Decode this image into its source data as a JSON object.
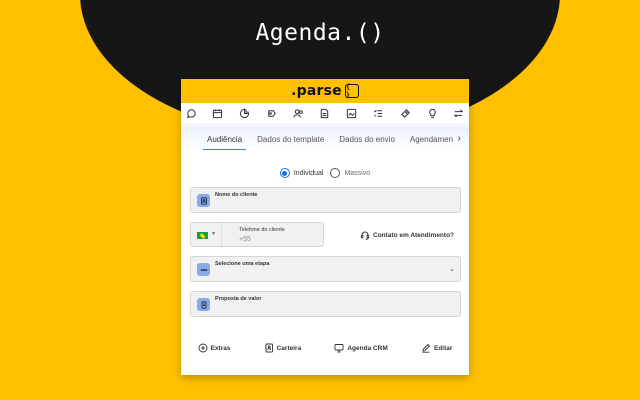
{
  "hero": {
    "title": "Agenda.()"
  },
  "brand": {
    "name": ".parse",
    "badge": "{ }"
  },
  "toolbar": {
    "icons": [
      "chat-bubble-icon",
      "calendar-icon",
      "pie-chart-icon",
      "tag-shield-icon",
      "users-icon",
      "document-icon",
      "image-gallery-icon",
      "list-check-icon",
      "ticket-icon",
      "lightbulb-icon",
      "swap-arrows-icon"
    ]
  },
  "tabs": {
    "items": [
      {
        "label": "Audiência"
      },
      {
        "label": "Dados do template"
      },
      {
        "label": "Dados do envio"
      },
      {
        "label": "Agendamen"
      }
    ],
    "more": "›"
  },
  "audience": {
    "individual": "Individual",
    "massivo": "Massivo"
  },
  "fields": {
    "client_name": "Nome do cliente",
    "phone_label": "Telefone do cliente",
    "phone_value": "+55",
    "stage": "Selecione uma etapa",
    "proposal": "Proposta de valor"
  },
  "contact_link": "Contato em Atendimento?",
  "actions": {
    "extras": "Extras",
    "carteira": "Carteira",
    "agenda_crm": "Agenda CRM",
    "editar": "Editar"
  },
  "colors": {
    "brand_yellow": "#FFC000",
    "blob": "#161616",
    "accent_blue": "#3b82c4",
    "icon_blue": "#8aa9e8"
  }
}
